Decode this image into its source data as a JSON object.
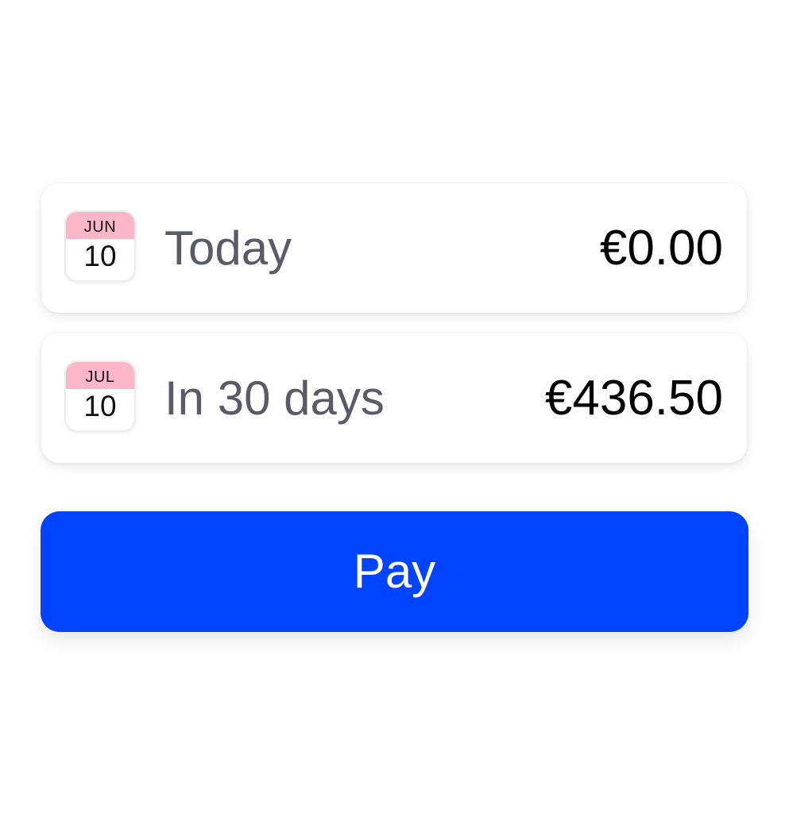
{
  "installments": [
    {
      "calendar": {
        "month": "JUN",
        "day": "10"
      },
      "label": "Today",
      "amount": "€0.00"
    },
    {
      "calendar": {
        "month": "JUL",
        "day": "10"
      },
      "label": "In 30 days",
      "amount": "€436.50"
    }
  ],
  "pay_button": {
    "label": "Pay",
    "color": "#0044ff"
  },
  "colors": {
    "calendar_header": "#fbb7c8",
    "label_text": "#5b5b66",
    "amount_text": "#000000"
  }
}
